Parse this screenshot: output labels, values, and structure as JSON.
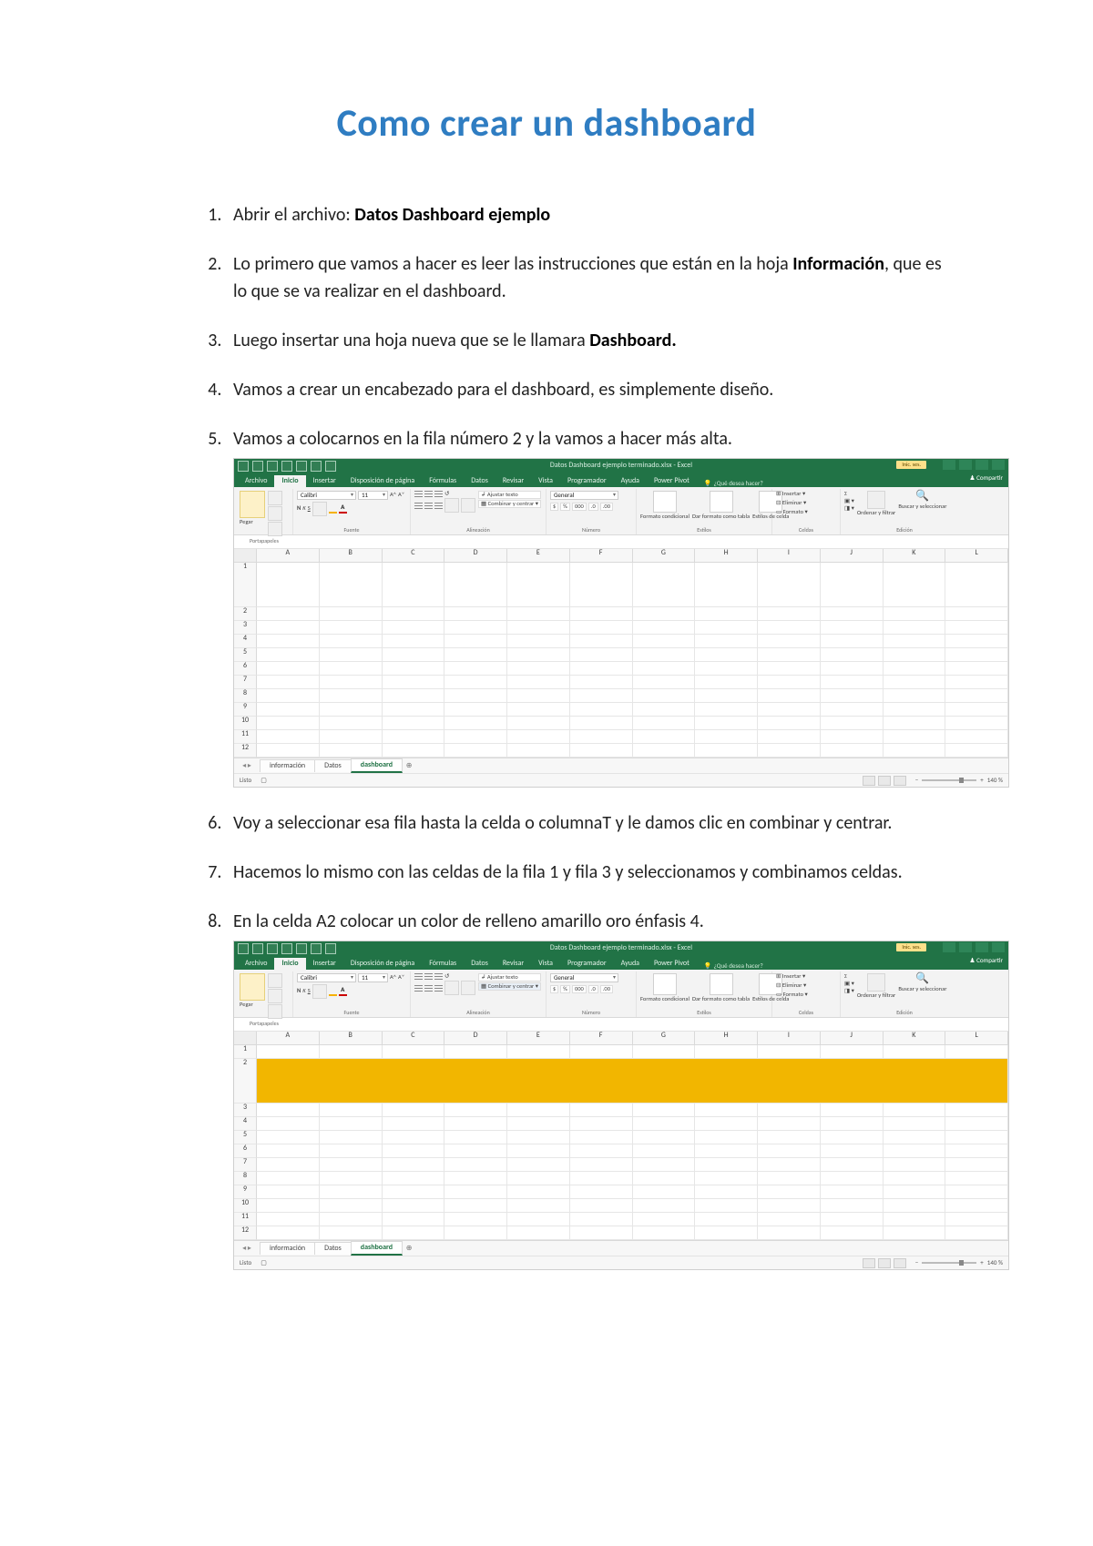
{
  "title": "Como crear un dashboard",
  "steps": {
    "s1_a": "Abrir el archivo: ",
    "s1_b": "Datos Dashboard ejemplo",
    "s2_a": "Lo primero que vamos a hacer es leer las instrucciones que están en la hoja ",
    "s2_b": "Información",
    "s2_c": ", que es lo que se va realizar en el dashboard.",
    "s3_a": "Luego insertar una hoja nueva que se le llamara ",
    "s3_b": "Dashboard.",
    "s4": "Vamos a crear un encabezado para el dashboard, es simplemente diseño.",
    "s5": "Vamos a colocarnos en la fila número 2 y la vamos a hacer más alta.",
    "s6": "Voy a seleccionar esa fila hasta la celda o columnaT y le damos clic en combinar y centrar.",
    "s7": "Hacemos lo mismo con las celdas de la fila 1 y fila 3 y seleccionamos y combinamos celdas.",
    "s8": "En la celda A2 colocar un color de relleno amarillo oro énfasis 4."
  },
  "excel": {
    "doc_title": "Datos Dashboard ejemplo terminado.xlsx - Excel",
    "badge": "Inic. ses.",
    "tabs": [
      "Archivo",
      "Inicio",
      "Insertar",
      "Disposición de página",
      "Fórmulas",
      "Datos",
      "Revisar",
      "Vista",
      "Programador",
      "Ayuda",
      "Power Pivot"
    ],
    "active_tab": "Inicio",
    "tell_me": "¿Qué desea hacer?",
    "share": "Compartir",
    "ribbon_groups": {
      "clipboard": {
        "name": "Portapapeles",
        "main": "Pegar"
      },
      "font": {
        "name": "Fuente",
        "family": "Calibri",
        "size": "11",
        "bold": "N",
        "italic": "K",
        "underline": "S"
      },
      "alignment": {
        "name": "Alineación",
        "wrap": "Ajustar texto",
        "merge": "Combinar y centrar"
      },
      "number": {
        "name": "Número",
        "format": "General",
        "decimals": "%  000"
      },
      "styles": {
        "name": "Estilos",
        "cf": "Formato condicional",
        "ft": "Dar formato como tabla",
        "cs": "Estilos de celda"
      },
      "cells": {
        "name": "Celdas",
        "ins": "Insertar",
        "del": "Eliminar",
        "fmt": "Formato"
      },
      "editing": {
        "name": "Edición",
        "sum": "Σ",
        "sort": "Ordenar y filtrar",
        "find": "Buscar y seleccionar"
      }
    },
    "columns": [
      "A",
      "B",
      "C",
      "D",
      "E",
      "F",
      "G",
      "H",
      "I",
      "J",
      "K",
      "L"
    ],
    "rows": [
      "1",
      "2",
      "3",
      "4",
      "5",
      "6",
      "7",
      "8",
      "9",
      "10",
      "11",
      "12"
    ],
    "sheet_tabs": [
      "información",
      "Datos",
      "dashboard"
    ],
    "active_sheet": "dashboard",
    "status_ready": "Listo",
    "zoom": "140 %"
  }
}
